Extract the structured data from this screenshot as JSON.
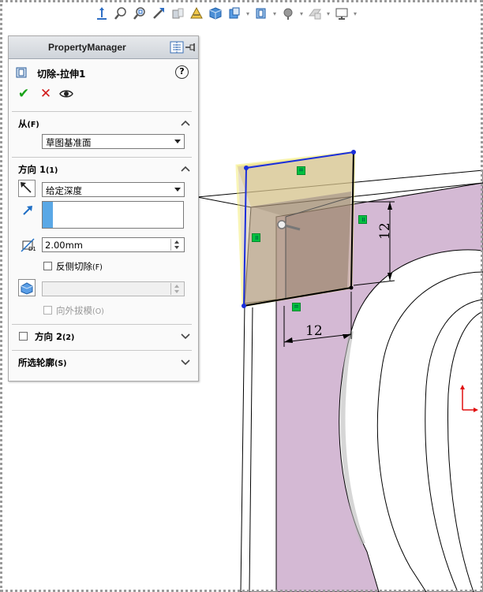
{
  "toolbar": {
    "icons": [
      "view-orientation-icon",
      "zoom-to-fit-icon",
      "zoom-to-area-icon",
      "previous-view-icon",
      "section-view-icon",
      "dynamic-annotation-icon",
      "view-orientation-cube-icon",
      "display-style-icon",
      "hide-show-items-icon",
      "edit-appearance-icon",
      "apply-scene-icon",
      "view-settings-icon"
    ]
  },
  "property_manager": {
    "title": "PropertyManager",
    "feature_name": "切除-拉伸1",
    "help": "?",
    "actions": {
      "ok": "✔",
      "cancel": "✕",
      "preview": "👁"
    }
  },
  "from_section": {
    "title": "从",
    "hotkey": "(F)",
    "start_condition": "草图基准面"
  },
  "direction1": {
    "title": "方向 1",
    "hotkey": "(1)",
    "end_condition": "给定深度",
    "depth": "2.00mm",
    "flip_side_label": "反侧切除",
    "flip_side_hotkey": "(F)",
    "draft_outward_label": "向外拔模",
    "draft_outward_hotkey": "(O)"
  },
  "direction2": {
    "title": "方向 2",
    "hotkey": "(2)"
  },
  "selected_contours": {
    "title": "所选轮廓",
    "hotkey": "(S)"
  },
  "graphics": {
    "dim_horizontal": "12",
    "dim_vertical": "12",
    "face_color": "#d3b8d3",
    "sketch_color": "#1a2edb",
    "preview_color": "#9b8470",
    "highlight_color": "#f7f36a"
  }
}
